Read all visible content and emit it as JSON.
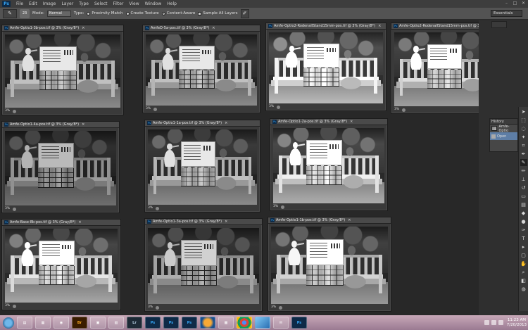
{
  "menubar": {
    "logo": "Ps",
    "items": [
      "File",
      "Edit",
      "Image",
      "Layer",
      "Type",
      "Select",
      "Filter",
      "View",
      "Window",
      "Help"
    ]
  },
  "options": {
    "brush_size": "23",
    "mode_label": "Mode:",
    "mode_value": "Normal",
    "type_label": "Type:",
    "type_options": [
      "Proximity Match",
      "Create Texture",
      "Content-Aware"
    ],
    "type_selected": "Content-Aware",
    "sample_all_layers": "Sample All Layers",
    "workspace": "Essentials"
  },
  "documents": [
    {
      "title": "Amfe-Optio1-3b-pos.tif @ 3% (Gray/8*)",
      "zoom": "3%"
    },
    {
      "title": "AmfeD-5a-pos.tif @ 3% (Gray/8*)",
      "zoom": "3%"
    },
    {
      "title": "Amfe-Optio2-RodenallStand15mm-pos.tif @ 3% (Gray/8*)",
      "zoom": "3%"
    },
    {
      "title": "Amfe-Optio2-RodenallStand15mm-pos.tif @ 3% (G...",
      "zoom": "3%"
    },
    {
      "title": "Amfe-Optio1-4a-pos.tif @ 3% (Gray/8*)",
      "zoom": "3%"
    },
    {
      "title": "Amfe-Optio1-1a-pos.tif @ 3% (Gray/8*)",
      "zoom": "3%"
    },
    {
      "title": "Amfe-Optio1-2a-pos.tif @ 3% (Gray/8*)",
      "zoom": "3%"
    },
    {
      "title": "Amfe-Base-8b-pos.tif @ 3% (Gray/8*)",
      "zoom": "3%"
    },
    {
      "title": "Amfe-Optio1-3a-pos.tif @ 3% (Gray/8*)",
      "zoom": "3%"
    },
    {
      "title": "Amfe-Optio1-1b-pos.tif @ 3% (Gray/8*)",
      "zoom": "3%"
    }
  ],
  "history": {
    "header": "History",
    "snapshot": "Amfe-Optio",
    "step": "Open"
  },
  "taskbar": {
    "apps": [
      "Br",
      "Lr",
      "Ps",
      "Ps",
      "Ps",
      "Ps"
    ],
    "time": "11:23 AM",
    "date": "7/20/2013"
  },
  "colors": {
    "menubar": "#3d3d3d",
    "optbar": "#535353",
    "workspace": "#282828",
    "selection": "#5e7ea6",
    "ps_blue": "#35a6f6"
  }
}
